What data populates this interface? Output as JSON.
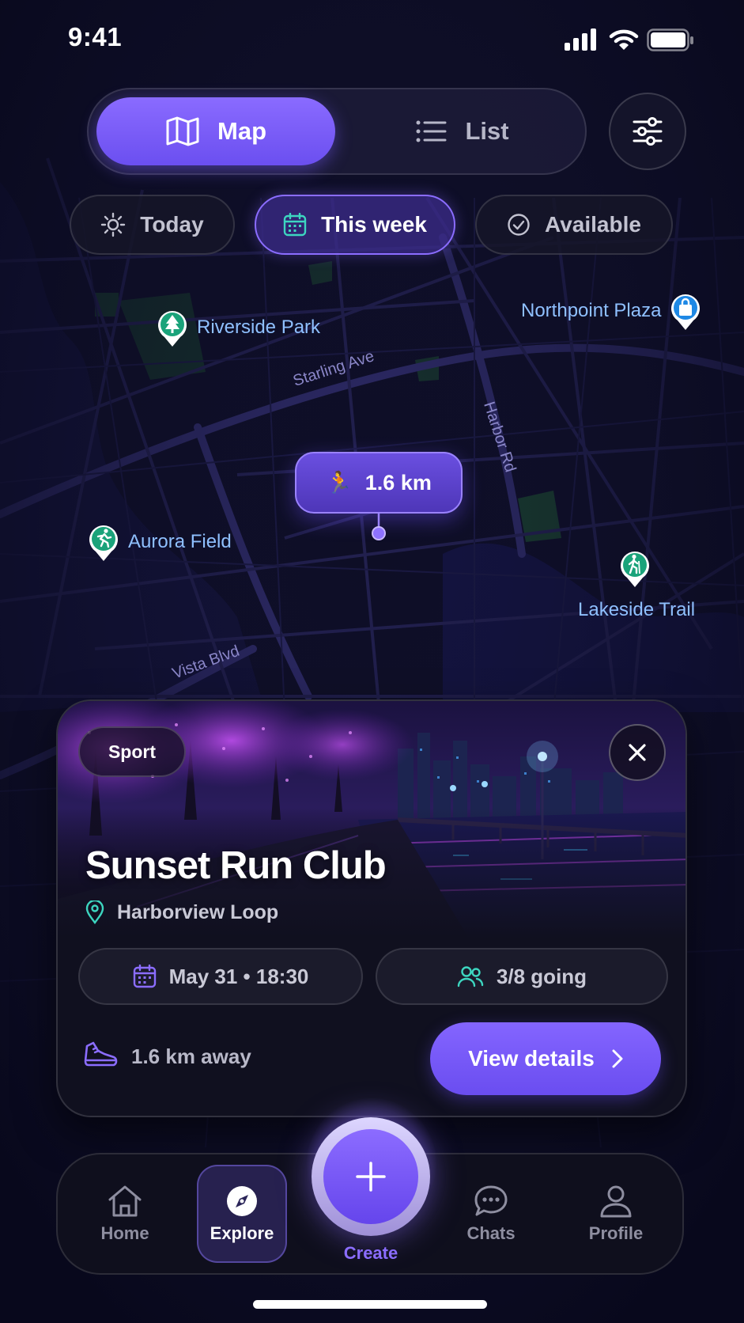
{
  "status_bar": {
    "time": "9:41",
    "icons": [
      "signal-icon",
      "wifi-icon",
      "battery-icon"
    ]
  },
  "view_toggle": {
    "map_label": "Map",
    "list_label": "List",
    "selected": "Map"
  },
  "filters": [
    {
      "label": "Today",
      "icon": "sun-icon",
      "active": false
    },
    {
      "label": "This week",
      "icon": "calendar-icon",
      "active": true
    },
    {
      "label": "Available",
      "icon": "check-circle-icon",
      "active": false
    }
  ],
  "map": {
    "places": [
      {
        "name": "Riverside Park",
        "icon": "tree-icon"
      },
      {
        "name": "Northpoint Plaza",
        "icon": "shopping-bag-icon"
      },
      {
        "name": "Aurora Field",
        "icon": "runner-icon"
      },
      {
        "name": "Lakeside Trail",
        "icon": "hiker-icon"
      }
    ],
    "streets": [
      "Starling Ave",
      "Harbor Rd",
      "Vista Blvd"
    ],
    "distance_bubble": {
      "emoji": "🏃",
      "text": "1.6 km"
    }
  },
  "event_card": {
    "category": "Sport",
    "title": "Sunset Run Club",
    "location": "Harborview Loop",
    "datetime": "May 31 • 18:30",
    "attendance": "3/8 going",
    "distance": "1.6 km away",
    "cta_label": "View details"
  },
  "tab_bar": {
    "items": [
      {
        "label": "Home",
        "icon": "home-icon"
      },
      {
        "label": "Explore",
        "icon": "compass-icon",
        "active": true
      },
      {
        "label": "Create",
        "icon": "plus-icon"
      },
      {
        "label": "Chats",
        "icon": "chat-icon"
      },
      {
        "label": "Profile",
        "icon": "person-icon"
      }
    ]
  },
  "colors": {
    "accent": "#7b5cff",
    "background": "#0b0b1f",
    "place_label": "#8fc0ff",
    "pin_green": "#1aa37a",
    "pin_blue": "#1e88e5",
    "teal_icon": "#3dd6c0"
  }
}
